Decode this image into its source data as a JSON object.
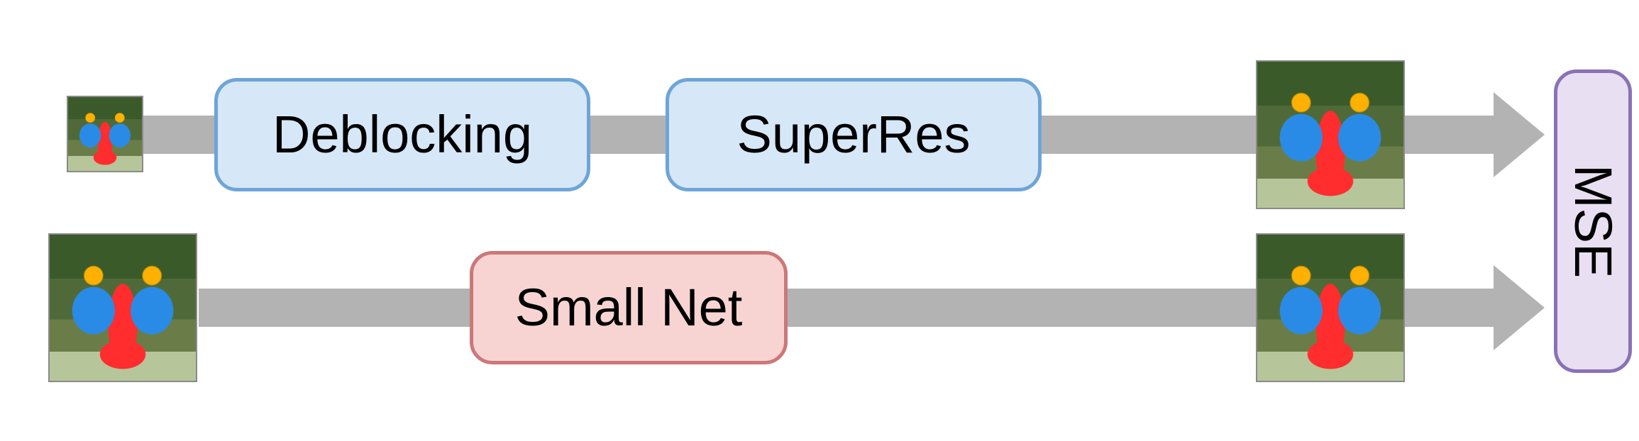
{
  "top": {
    "block1_label": "Deblocking",
    "block2_label": "SuperRes"
  },
  "bottom": {
    "block_label": "Small Net"
  },
  "loss_label": "MSE",
  "thumbs": {
    "top_input_desc": "mandrill-small",
    "bottom_input_desc": "mandrill-large",
    "top_output_desc": "mandrill-large",
    "bottom_output_desc": "mandrill-large"
  },
  "colors": {
    "arrow": "#b3b3b3",
    "blue_fill": "#d6e7f8",
    "blue_stroke": "#6ea5d8",
    "red_fill": "#f7d4d2",
    "red_stroke": "#cc7878",
    "purple_fill": "#e9dff2",
    "purple_stroke": "#8a72b5"
  }
}
